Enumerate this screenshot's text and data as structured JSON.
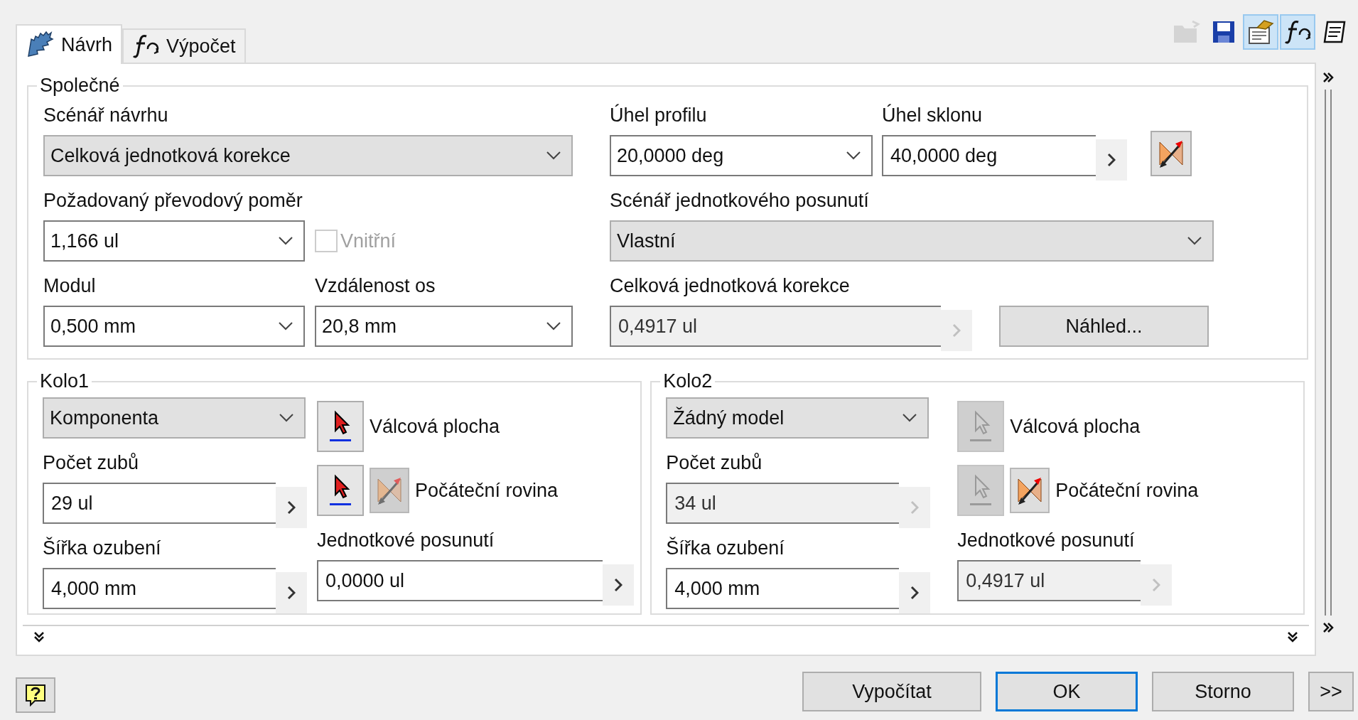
{
  "tabs": [
    {
      "label": "Návrh",
      "selected": true
    },
    {
      "label": "Výpočet",
      "selected": false
    }
  ],
  "toolbar": [
    {
      "selected": false,
      "disabled": true
    },
    {
      "selected": false,
      "disabled": false
    },
    {
      "selected": true,
      "disabled": false
    },
    {
      "selected": true,
      "disabled": false
    },
    {
      "selected": false,
      "disabled": false
    }
  ],
  "common": {
    "title": "Společné",
    "design_scenario": {
      "label": "Scénář návrhu",
      "value": "Celková jednotková korekce",
      "kind": "dropdown"
    },
    "gear_ratio": {
      "label": "Požadovaný převodový poměr",
      "value": "1,166 ul",
      "kind": "combo"
    },
    "internal": {
      "label": "Vnitřní",
      "checked": false,
      "disabled": true
    },
    "module": {
      "label": "Modul",
      "value": "0,500 mm",
      "kind": "combo"
    },
    "center_distance": {
      "label": "Vzdálenost os",
      "value": "20,8 mm",
      "kind": "combo"
    },
    "pressure_angle": {
      "label": "Úhel profilu",
      "value": "20,0000 deg",
      "kind": "combo"
    },
    "helix_angle": {
      "label": "Úhel sklonu",
      "value": "40,0000 deg",
      "kind": "spin",
      "disabled": false
    },
    "shift_scenario": {
      "label": "Scénář jednotkového posunutí",
      "value": "Vlastní",
      "kind": "dropdown"
    },
    "total_correction": {
      "label": "Celková jednotková korekce",
      "value": "0,4917 ul",
      "kind": "spin",
      "disabled": true
    },
    "preview_button": "Náhled..."
  },
  "gears": [
    {
      "title": "Kolo1",
      "model": {
        "value": "Komponenta",
        "kind": "dropdown"
      },
      "teeth": {
        "label": "Počet zubů",
        "value": "29 ul",
        "kind": "spin",
        "disabled": false
      },
      "width": {
        "label": "Šířka ozubení",
        "value": "4,000 mm",
        "kind": "spin",
        "disabled": false
      },
      "cylindrical_face": {
        "label": "Válcová plocha",
        "disabled": false
      },
      "start_plane": {
        "label": "Počáteční rovina",
        "disabled": false,
        "plane_disabled": true
      },
      "unit_shift": {
        "label": "Jednotkové posunutí",
        "value": "0,0000 ul",
        "kind": "spin",
        "disabled": false
      }
    },
    {
      "title": "Kolo2",
      "model": {
        "value": "Žádný model",
        "kind": "dropdown"
      },
      "teeth": {
        "label": "Počet zubů",
        "value": "34 ul",
        "kind": "spin",
        "disabled": true
      },
      "width": {
        "label": "Šířka ozubení",
        "value": "4,000 mm",
        "kind": "spin",
        "disabled": false
      },
      "cylindrical_face": {
        "label": "Válcová plocha",
        "disabled": true
      },
      "start_plane": {
        "label": "Počáteční rovina",
        "disabled": true,
        "plane_disabled": false
      },
      "unit_shift": {
        "label": "Jednotkové posunutí",
        "value": "0,4917 ul",
        "kind": "spin",
        "disabled": true
      }
    }
  ],
  "footer": {
    "buttons": [
      {
        "label": "Vypočítat",
        "default": false
      },
      {
        "label": "OK",
        "default": true
      },
      {
        "label": "Storno",
        "default": false
      },
      {
        "label": ">>",
        "default": false
      }
    ]
  }
}
